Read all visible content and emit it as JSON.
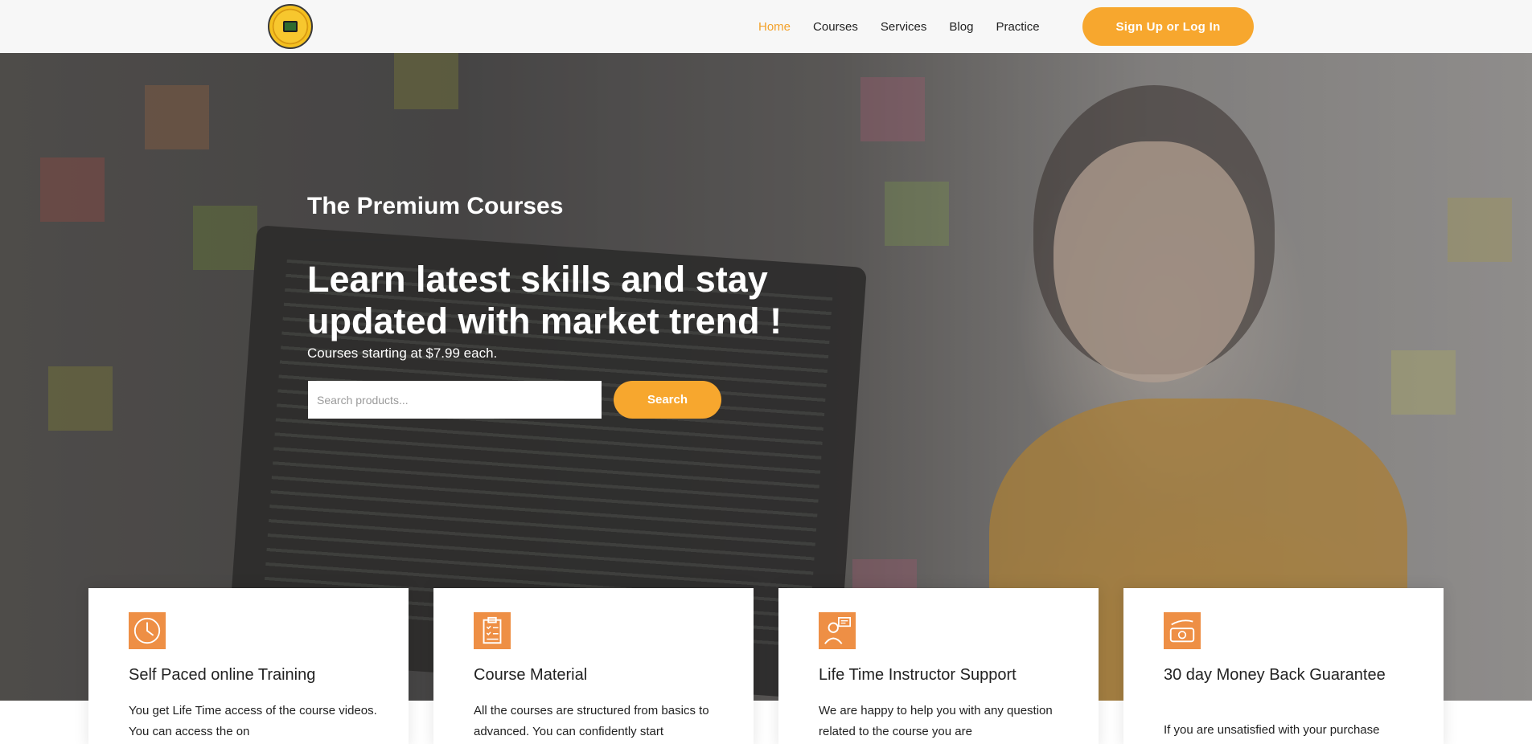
{
  "header": {
    "nav": [
      {
        "label": "Home",
        "active": true
      },
      {
        "label": "Courses",
        "active": false
      },
      {
        "label": "Services",
        "active": false
      },
      {
        "label": "Blog",
        "active": false
      },
      {
        "label": "Practice",
        "active": false
      }
    ],
    "cta_label": "Sign Up or Log In",
    "logo_icon": "logo-badge-icon"
  },
  "hero": {
    "kicker": "The Premium Courses",
    "headline": "Learn latest skills and stay updated with market trend !",
    "sub": "Courses starting at $7.99 each.",
    "search_placeholder": "Search products...",
    "search_label": "Search"
  },
  "features": [
    {
      "icon": "clock-icon",
      "title": "Self Paced online Training",
      "text": "You get Life Time access of the course videos. You can access the on"
    },
    {
      "icon": "clipboard-checklist-icon",
      "title": "Course Material",
      "text": "All the courses are structured from basics to advanced. You can confidently start"
    },
    {
      "icon": "instructor-support-icon",
      "title": "Life Time Instructor Support",
      "text": "We are happy to help you with any question related to the course you are"
    },
    {
      "icon": "money-back-icon",
      "title": "30 day Money Back Guarantee",
      "text": "If you are unsatisfied with your purchase"
    }
  ],
  "colors": {
    "accent": "#f7a72e",
    "icon_bg": "#ee8f45",
    "topbar": "#f7f7f7"
  }
}
